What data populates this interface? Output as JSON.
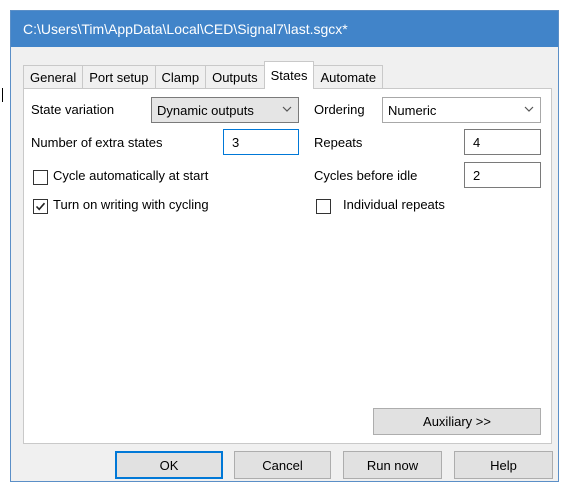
{
  "window": {
    "title": "C:\\Users\\Tim\\AppData\\Local\\CED\\Signal7\\last.sgcx*"
  },
  "tabs": [
    {
      "label": "General"
    },
    {
      "label": "Port setup"
    },
    {
      "label": "Clamp"
    },
    {
      "label": "Outputs"
    },
    {
      "label": "States",
      "active": true
    },
    {
      "label": "Automate"
    }
  ],
  "states": {
    "state_variation_label": "State variation",
    "state_variation_value": "Dynamic outputs",
    "ordering_label": "Ordering",
    "ordering_value": "Numeric",
    "extra_states_label": "Number of extra states",
    "extra_states_value": "3",
    "repeats_label": "Repeats",
    "repeats_value": "4",
    "cycle_auto_label": "Cycle automatically at start",
    "cycle_auto_checked": false,
    "cycles_idle_label": "Cycles before idle",
    "cycles_idle_value": "2",
    "writing_label": "Turn on writing with cycling",
    "writing_checked": true,
    "individual_label": "Individual repeats",
    "individual_checked": false,
    "auxiliary_label": "Auxiliary >>"
  },
  "buttons": {
    "ok": "OK",
    "cancel": "Cancel",
    "run_now": "Run now",
    "help": "Help"
  },
  "colors": {
    "titlebar": "#4184c9",
    "focus": "#0078d7"
  }
}
